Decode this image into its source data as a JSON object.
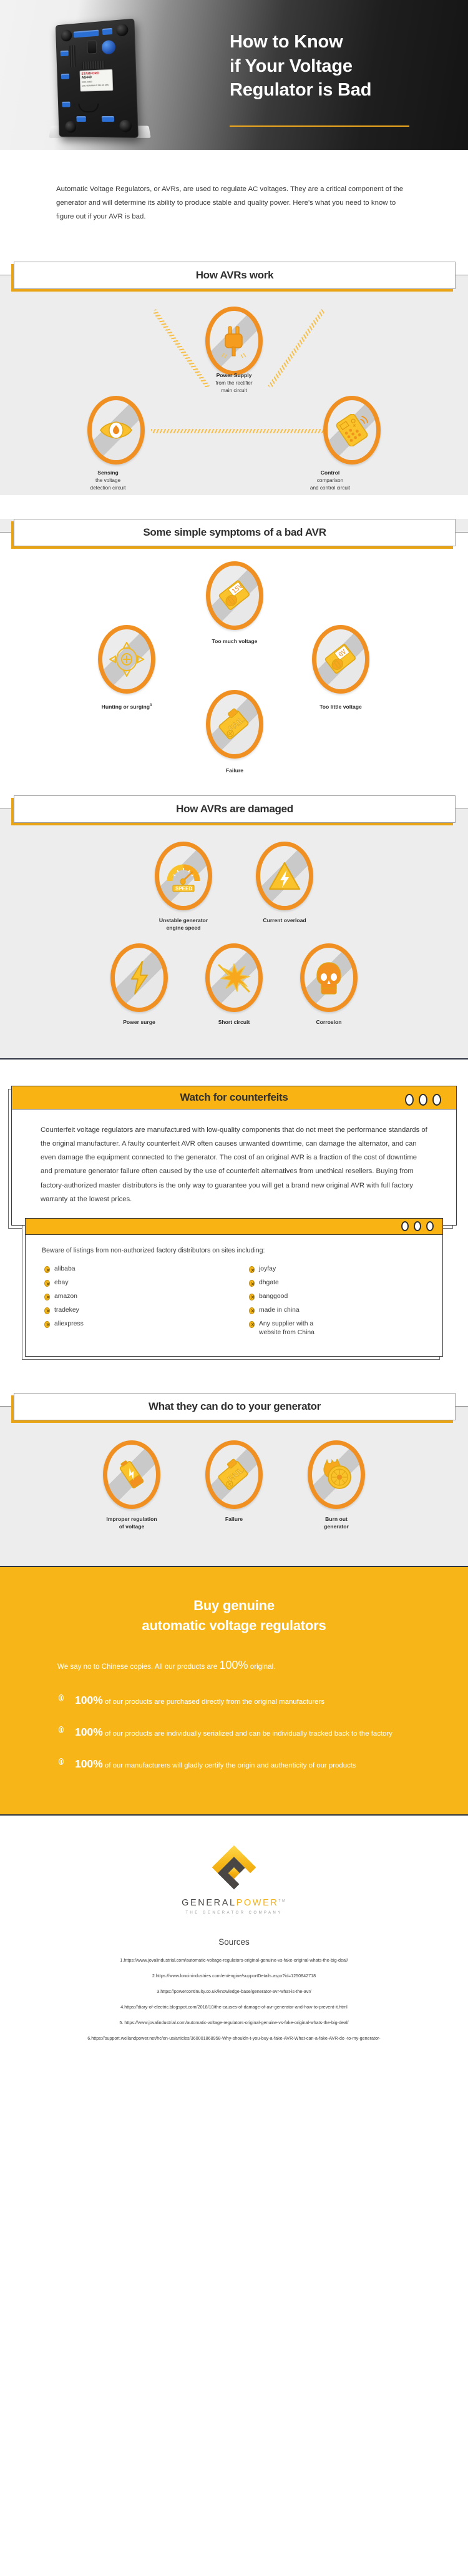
{
  "hero": {
    "title_line1": "How to Know",
    "title_line2": "if Your Voltage",
    "title_line3": "Regulator is Bad",
    "product_brand": "STAMFORD",
    "product_model": "AS440",
    "product_code": "E000-24463",
    "product_tiny": "USE TERMINALS 3&4 AS MIN"
  },
  "intro": {
    "paragraph": "Automatic Voltage Regulators, or AVRs, are used to regulate AC voltages. They are a critical component of the generator and will determine its ability to produce stable and quality power. Here's what you need to know to figure out if your AVR is bad."
  },
  "how_avrs_work": {
    "heading": "How AVRs work",
    "nodes": [
      {
        "title": "Power Supply",
        "line1": "from the rectifier",
        "line2": "main circuit",
        "icon": "plug-icon"
      },
      {
        "title": "Sensing",
        "line1": "the voltage",
        "line2": "detection circuit",
        "icon": "eye-icon"
      },
      {
        "title": "Control",
        "line1": "comparison",
        "line2": "and control circuit",
        "icon": "remote-control-icon"
      }
    ]
  },
  "symptoms": {
    "heading": "Some simple symptoms of a bad AVR",
    "items": [
      {
        "label": "Too much voltage",
        "sup": "",
        "icon": "meter-high-voltage-icon"
      },
      {
        "label": "Hunting or surging",
        "sup": "3",
        "icon": "fluctuation-arrows-icon"
      },
      {
        "label": "Too little voltage",
        "sup": "",
        "icon": "meter-low-voltage-icon"
      },
      {
        "label": "Failure",
        "sup": "",
        "icon": "fail-tag-icon"
      }
    ]
  },
  "damaged": {
    "heading": "How AVRs are damaged",
    "row1": [
      {
        "label_line1": "Unstable generator",
        "label_line2": "engine speed",
        "icon": "speedometer-icon"
      },
      {
        "label_line1": "Current overload",
        "label_line2": "",
        "icon": "high-voltage-warning-icon"
      }
    ],
    "row2": [
      {
        "label_line1": "Power surge",
        "label_line2": "",
        "icon": "lightning-bolt-icon"
      },
      {
        "label_line1": "Short circuit",
        "label_line2": "",
        "icon": "spark-burst-icon"
      },
      {
        "label_line1": "Corrosion",
        "label_line2": "",
        "icon": "skull-icon"
      }
    ]
  },
  "counterfeits": {
    "heading": "Watch for counterfeits",
    "body": "Counterfeit voltage regulators are manufactured with low-quality components that do not meet the performance standards of the original manufacturer. A faulty counterfeit AVR often causes unwanted downtime, can damage the alternator, and can even damage the equipment connected to the generator. The cost of an original AVR is a fraction of the cost of downtime and premature generator failure often caused by the use of counterfeit alternatives from unethical resellers. Buying from factory-authorized master distributors is the only way to guarantee you will get a brand new original AVR with full factory warranty at the lowest prices.",
    "sub_lead": "Beware of listings from non-authorized factory distributors on sites including:",
    "sites_left": [
      "alibaba",
      "ebay",
      "amazon",
      "tradekey",
      "aliexpress"
    ],
    "sites_right": [
      "joyfay",
      "dhgate",
      "banggood",
      "made in china",
      "Any supplier with a website from China"
    ]
  },
  "generator_effects": {
    "heading": "What they can do to your generator",
    "items": [
      {
        "label_line1": "Improper regulation",
        "label_line2": "of voltage",
        "icon": "battery-fault-icon"
      },
      {
        "label_line1": "Failure",
        "label_line2": "",
        "icon": "fail-tag-icon"
      },
      {
        "label_line1": "Burn out",
        "label_line2": "generator",
        "icon": "burning-rotor-icon"
      }
    ]
  },
  "cta": {
    "title_line1": "Buy genuine",
    "title_line2": "automatic voltage regulators",
    "lead_pre": "We say no to Chinese copies. All our products are ",
    "lead_big": "100%",
    "lead_post": " original.",
    "bullets": [
      {
        "pct": "100%",
        "text": " of our products are purchased directly from the original manufacturers"
      },
      {
        "pct": "100%",
        "text": " of our products are individually serialized and can be individually tracked back to the factory"
      },
      {
        "pct": "100%",
        "text": " of our manufacturers will gladly certify the origin and authenticity of our products"
      }
    ]
  },
  "logo": {
    "word_dark": "GENERAL",
    "word_gold": "POWER",
    "tm": "TM",
    "tagline": "THE GENERATOR COMPANY"
  },
  "sources": {
    "heading": "Sources",
    "items": [
      "1.https://www.jovalindustrial.com/automatic-voltage-regulators-original-genuine-vs-fake-original-whats-the-big-deal/",
      "2.https://www.loncinindustries.com/en/engine/supportDetails.aspx?id=1250842718",
      "3.https://powercontinuity.co.uk/knowledge-base/generator-avr-what-is-the-avr/",
      "4.https://diary-of-electric.blogspot.com/2018/10/the-causes-of-damage-of-avr-generator-and-how-to-prevent-it.html",
      "5. https://www.jovalindustrial.com/automatic-voltage-regulators-original-genuine-vs-fake-original-whats-the-big-deal/",
      "6.https://support.wellandpower.net/hc/en-us/articles/360001868958-Why-shouldn-t-you-buy-a-fake-AVR-What-can-a-fake-AVR-do -to-my-generator-"
    ]
  },
  "colors": {
    "accent_orange": "#f09022",
    "accent_yellow": "#f9b312",
    "band_grey": "#ededed",
    "dark": "#2f2f2f"
  }
}
